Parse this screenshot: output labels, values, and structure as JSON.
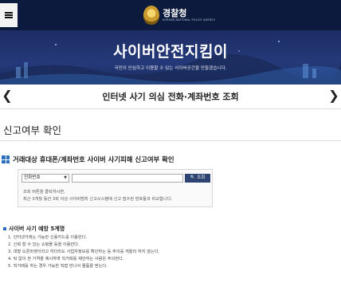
{
  "header": {
    "menu_icon": "hamburger-icon",
    "emblem_icon": "police-emblem-icon",
    "brand_name": "경찰청",
    "brand_sub": "KOREAN NATIONAL POLICE AGENCY"
  },
  "hero": {
    "title": "사이버안전지킴이",
    "subtitle": "국민이 안심하고 이용할 수 있는 사이버공간을 만들겠습니다."
  },
  "slider": {
    "prev_icon": "chevron-left-icon",
    "next_icon": "chevron-right-icon",
    "title": "인터넷 사기 의심 전화·계좌번호 조회"
  },
  "page": {
    "title": "신고여부 확인"
  },
  "section": {
    "icon": "grid-icon",
    "title": "거래대상 휴대폰/계좌번호 사이버 사기피해 신고여부 확인"
  },
  "search": {
    "select_value": "전화번호",
    "input_value": "",
    "button_label": "조회",
    "button_icon": "search-icon",
    "info_1": "조회 버튼을 클릭하시면,",
    "info_2": "최근 3개월 동안 3회 이상 사이버범죄 신고시스템에 신고 접수된 번호들과 비교합니다."
  },
  "tips": {
    "title": "사이버 사기 예방 5계명",
    "items": [
      "1. 인터넷거래는 가능한 신용카드를 이용한다.",
      "2. 신뢰 할 수 있는 쇼핑몰 등을 이용한다.",
      "3. 대형 오픈마켓이라고 하더라도 사업자정보를 확인하는 등 주의를 게을리 하지 않는다.",
      "4. 턱 없이 싼 가격을 제시하며 직거래를 제안하는 사람은 주의한다.",
      "5. 직거래를 하는 경우 가능한 직접 만나서 물품을 받는다."
    ]
  },
  "colors": {
    "header_bg": "#0c1a3d",
    "hero_bg": "#25397a",
    "accent": "#2a6ebd",
    "button_bg": "#2d4372"
  }
}
